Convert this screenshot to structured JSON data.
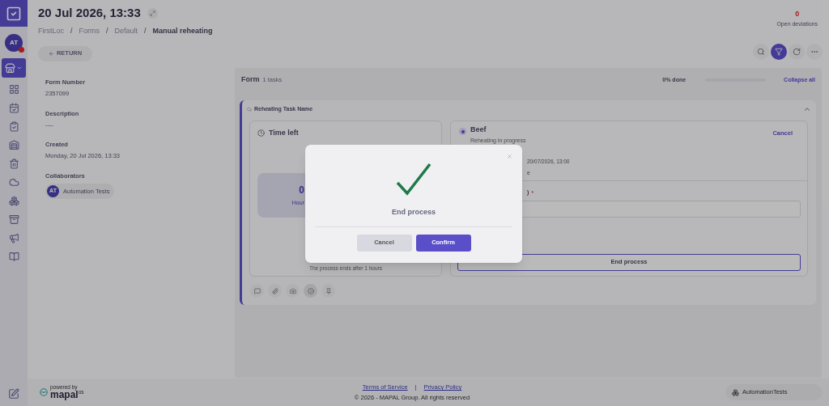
{
  "sidebar": {
    "avatar": "AT",
    "avatar_alert": true,
    "items": [
      {
        "selected": true
      },
      {
        "selected": false
      },
      {
        "selected": false
      },
      {
        "selected": false
      },
      {
        "selected": false
      },
      {
        "selected": false
      },
      {
        "selected": false
      },
      {
        "selected": false
      },
      {
        "selected": false
      },
      {
        "selected": false
      },
      {
        "selected": false
      }
    ]
  },
  "header": {
    "title": "20 Jul 2026, 13:33",
    "breadcrumb": [
      {
        "label": "FirstLoc",
        "current": false
      },
      {
        "separator": "/",
        "label": "Forms",
        "current": false
      },
      {
        "separator": "/",
        "label": "Default",
        "current": false
      },
      {
        "separator": "/",
        "label": "Manual reheating",
        "current": true
      }
    ],
    "deviations": {
      "count": "0",
      "label": "Open deviations"
    }
  },
  "return_button": "RETURN",
  "toolbar": [
    {
      "selected": false
    },
    {
      "selected": true
    },
    {
      "selected": false
    },
    {
      "selected": false
    }
  ],
  "details": [
    {
      "label": "Form Number",
      "value": "2357099"
    },
    {
      "label": "Description",
      "value": "----"
    },
    {
      "label": "Created",
      "value": "Monday, 20 Jul 2026, 13:33"
    }
  ],
  "collaborators": {
    "label": "Collaborators",
    "people": [
      {
        "initials": "AT",
        "name": "Automation Tests"
      }
    ]
  },
  "form": {
    "title": "Form",
    "count": "1 tasks",
    "progress": "0% done",
    "level": 0,
    "collapse": "Collapse all",
    "task": {
      "name": "Reheating Task Name",
      "expanded": true,
      "time_card": {
        "title": "Time left",
        "value": "0",
        "unit": "Hour",
        "note": "The process ends after 1 hours"
      },
      "item": {
        "name": "Beef",
        "status": "Reheating in progress",
        "cancel": "Cancel",
        "date": "20/07/2026, 13:00",
        "fragment": "e",
        "field_label": ")",
        "required_mark": "*",
        "button": "End process"
      },
      "actions": [
        {
          "selected": false
        },
        {
          "selected": false
        },
        {
          "selected": false
        },
        {
          "selected": true
        },
        {
          "selected": false
        }
      ]
    }
  },
  "dialog": {
    "title": "End process",
    "buttons": [
      {
        "label": "Cancel",
        "kind": "secondary"
      },
      {
        "label": "Confirm",
        "kind": "primary"
      }
    ]
  },
  "footer": {
    "powered_by": "powered by",
    "brand": "mapal",
    "brand_suffix": "os",
    "links": [
      "Terms of Service",
      "Privacy Policy"
    ],
    "separator": "|",
    "copyright": "© 2026 - MAPAL Group. All rights reserved",
    "account": "AutomationTests"
  }
}
